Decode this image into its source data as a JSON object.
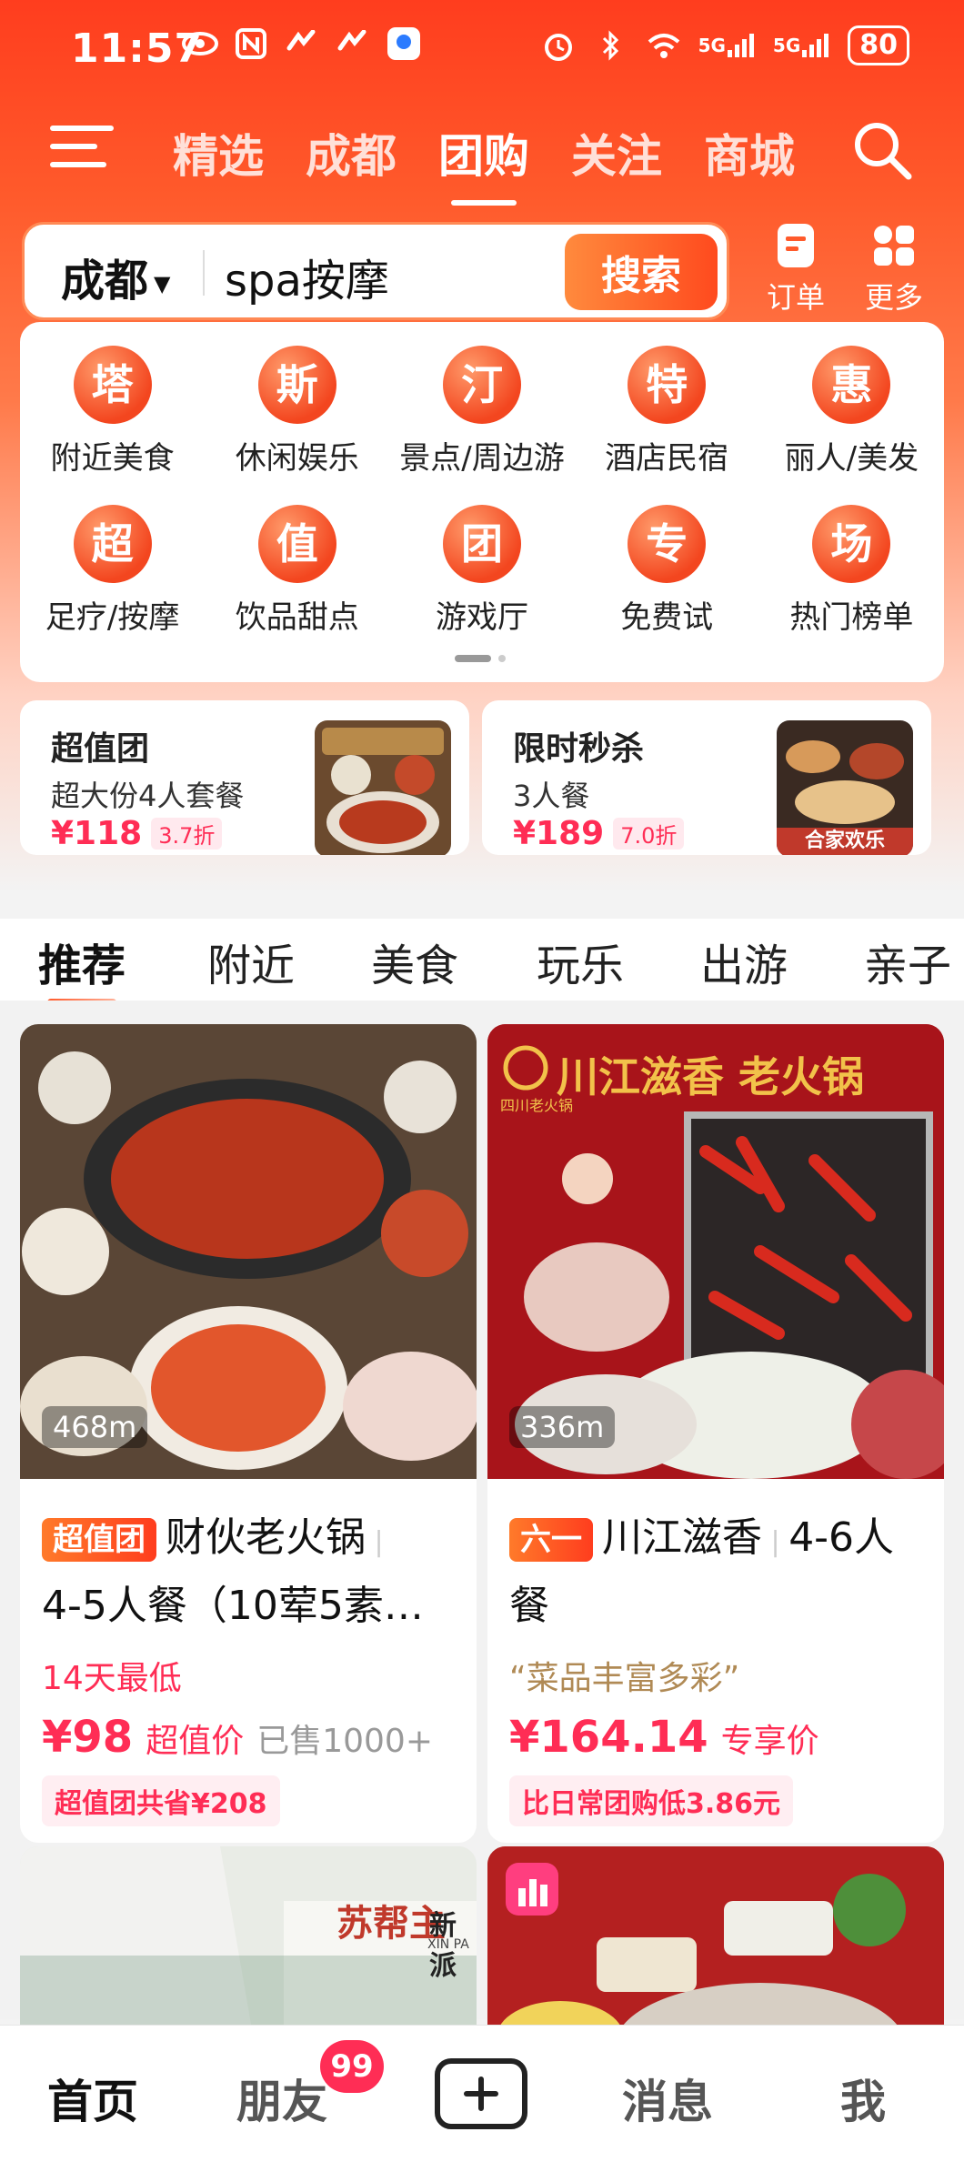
{
  "status_bar": {
    "time": "11:57",
    "network_1": "5G",
    "network_2": "5G",
    "battery": "80"
  },
  "top_nav": {
    "tabs": [
      "精选",
      "成都",
      "团购",
      "关注",
      "商城"
    ],
    "active_tab": "团购"
  },
  "search": {
    "city": "成都",
    "query": "spa按摩",
    "button_label": "搜索"
  },
  "quick_actions": [
    {
      "label": "订单",
      "icon": "order-icon"
    },
    {
      "label": "更多",
      "icon": "grid-icon"
    }
  ],
  "categories": [
    {
      "glyph": "塔",
      "label": "附近美食"
    },
    {
      "glyph": "斯",
      "label": "休闲娱乐"
    },
    {
      "glyph": "汀",
      "label": "景点/周边游"
    },
    {
      "glyph": "特",
      "label": "酒店民宿"
    },
    {
      "glyph": "惠",
      "label": "丽人/美发"
    },
    {
      "glyph": "超",
      "label": "足疗/按摩"
    },
    {
      "glyph": "值",
      "label": "饮品甜点"
    },
    {
      "glyph": "团",
      "label": "游戏厅"
    },
    {
      "glyph": "专",
      "label": "免费试"
    },
    {
      "glyph": "场",
      "label": "热门榜单"
    }
  ],
  "promos": [
    {
      "title": "超值团",
      "subtitle": "超大份4人套餐",
      "price": "¥118",
      "discount": "3.7折"
    },
    {
      "title": "限时秒杀",
      "subtitle": "3人餐",
      "price": "¥189",
      "discount": "7.0折",
      "image_caption": "合家欢乐"
    }
  ],
  "content_tabs": [
    "推荐",
    "附近",
    "美食",
    "玩乐",
    "出游",
    "亲子"
  ],
  "feed": [
    {
      "distance": "468m",
      "badge": "超值团",
      "title": "财伙老火锅",
      "title_cont": "4-5人餐（10荤5素…",
      "subtitle": "14天最低",
      "price": "¥98",
      "price_label": "超值价",
      "sold": "已售1000+",
      "tag": "超值团共省¥208"
    },
    {
      "distance": "336m",
      "badge": "六一",
      "title": "川江滋香",
      "title_cont": "4-6人餐",
      "subtitle": "“菜品丰富多彩”",
      "price": "¥164.14",
      "price_label": "专享价",
      "tag": "比日常团购低3.86元",
      "image_text": "川江滋香 老火锅",
      "image_subtext": "四川老火锅"
    }
  ],
  "feed_next_image_text": {
    "brand": "苏帮主",
    "name": "新派",
    "latin": "XIN PA"
  },
  "bottom_nav": {
    "tabs": [
      "首页",
      "朋友",
      "消息",
      "我"
    ],
    "active": "首页",
    "friends_badge": "99"
  },
  "colors": {
    "brand_red": "#ff3d1e",
    "price_pink": "#ff2d55"
  }
}
